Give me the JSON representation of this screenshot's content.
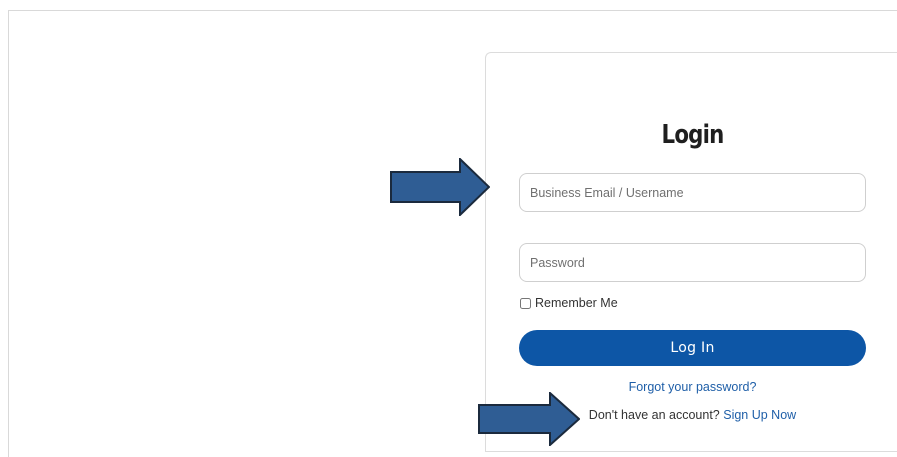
{
  "login_card": {
    "title": "Login",
    "email_placeholder": "Business Email / Username",
    "password_placeholder": "Password",
    "remember_label": "Remember Me",
    "submit_label": "Log In",
    "forgot_label": "Forgot your password?",
    "signup_prompt": "Don't have an account?",
    "signup_link": "Sign Up Now"
  },
  "annotations": {
    "arrow_color": "#2f5d94",
    "arrow_outline": "#1b2a3d",
    "arrows": [
      "arrow-right-icon",
      "arrow-right-icon"
    ]
  },
  "colors": {
    "button": "#0d56a6",
    "link": "#1f5fa8"
  }
}
